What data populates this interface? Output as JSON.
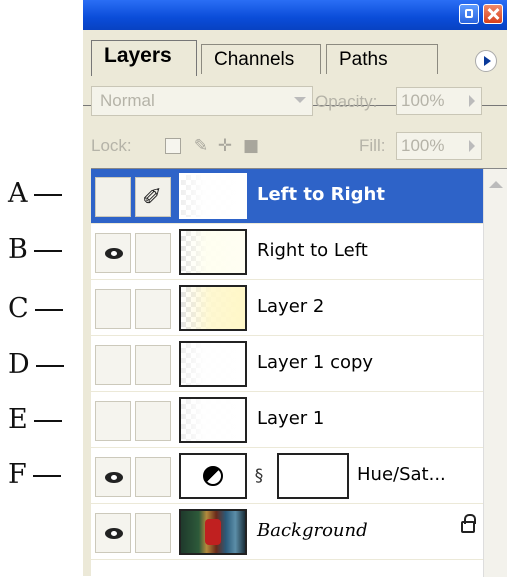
{
  "callouts": [
    "A",
    "B",
    "C",
    "D",
    "E",
    "F"
  ],
  "tabs": [
    {
      "label": "Layers",
      "active": true
    },
    {
      "label": "Channels",
      "active": false
    },
    {
      "label": "Paths",
      "active": false
    }
  ],
  "blend_mode": {
    "value": "Normal"
  },
  "opacity": {
    "label": "Opacity:",
    "value": "100%"
  },
  "lock": {
    "label": "Lock:"
  },
  "fill": {
    "label": "Fill:",
    "value": "100%"
  },
  "layers": [
    {
      "name": "Left to Right",
      "visible": false,
      "selected": true,
      "brush": true
    },
    {
      "name": "Right to Left",
      "visible": true,
      "selected": false
    },
    {
      "name": "Layer 2",
      "visible": false,
      "selected": false
    },
    {
      "name": "Layer 1 copy",
      "visible": false,
      "selected": false
    },
    {
      "name": "Layer 1",
      "visible": false,
      "selected": false
    },
    {
      "name": "Hue/Sat...",
      "visible": true,
      "selected": false,
      "adjustment": true
    },
    {
      "name": "Background",
      "visible": true,
      "selected": false,
      "locked": true
    }
  ],
  "colors": {
    "title_blue": "#0a4cd8",
    "selected_row": "#2e63c8",
    "panel_bg": "#ece9d8"
  }
}
